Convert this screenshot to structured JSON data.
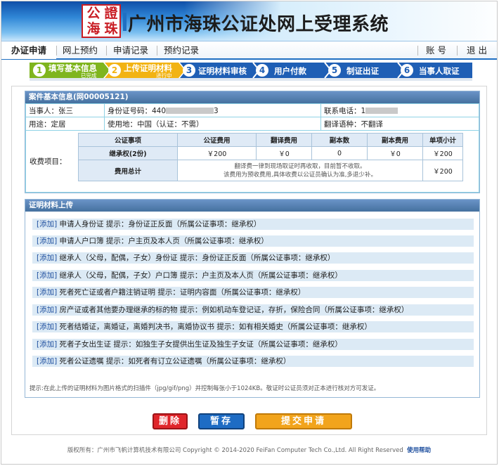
{
  "header": {
    "logo_chars": [
      "公",
      "證",
      "海",
      "珠"
    ],
    "title": "广州市海珠公证处网上受理系统"
  },
  "nav": {
    "items": [
      {
        "label": "办证申请",
        "active": true
      },
      {
        "label": "网上预约"
      },
      {
        "label": "申请记录"
      },
      {
        "label": "预约记录"
      }
    ],
    "account": "账 号",
    "logout": "退 出"
  },
  "steps": [
    {
      "num": "1",
      "label": "填写基本信息",
      "sub": "已完成"
    },
    {
      "num": "2",
      "label": "上传证明材料",
      "sub": "进行中"
    },
    {
      "num": "3",
      "label": "证明材料审核"
    },
    {
      "num": "4",
      "label": "用户付款"
    },
    {
      "num": "5",
      "label": "制证出证"
    },
    {
      "num": "6",
      "label": "当事人取证"
    }
  ],
  "case_info": {
    "title": "案件基本信息(网00005121)",
    "party": "当事人：张三",
    "id_label": "身份证号码：440",
    "id_tail": "3",
    "phone_label": "联系电话：1",
    "purpose": "用途：定居",
    "use_place": "使用地：中国（认证：不需）",
    "translate": "翻译语种：不翻译",
    "fee_label": "收费项目：",
    "fee_headers": [
      "公证事项",
      "公证费用",
      "翻译费用",
      "副本数",
      "副本费用",
      "单项小计"
    ],
    "fee_row": [
      "继承权(2份)",
      "￥200",
      "￥0",
      "0",
      "￥0",
      "￥200"
    ],
    "total_label": "费用总计",
    "total_note_1": "翻译费一律到现场取证时再收取，目前暂不收取。",
    "total_note_2": "该费用为预收费用,具体收费以公证员确认为准,多退少补。",
    "total_value": "￥200"
  },
  "upload": {
    "title": "证明材料上传",
    "add_label": "[添加]",
    "items": [
      "申请人身份证  提示：身份证正反面（所属公证事项：继承权）",
      "申请人户口簿  提示：户主页及本人页（所属公证事项：继承权）",
      "继承人（父母，配偶，子女）身份证  提示：身份证正反面（所属公证事项：继承权）",
      "继承人（父母，配偶，子女）户口簿  提示：户主页及本人页（所属公证事项：继承权）",
      "死者死亡证或者户籍注销证明  提示：证明内容面（所属公证事项：继承权）",
      "房产证或者其他要办理继承的标的物  提示：例如机动车登记证，存折，保险合同（所属公证事项：继承权）",
      "死者结婚证，离婚证，离婚判决书，离婚协议书  提示：如有相关婚史（所属公证事项：继承权）",
      "死者子女出生证  提示：如独生子女提供出生证及独生子女证（所属公证事项：继承权）",
      "死者公证遗嘱  提示：如死者有订立公证遗嘱（所属公证事项：继承权）"
    ],
    "hint": "提示:在此上传的证明材料为图片格式的扫描件（jpg/gif/png）并控制每张小于1024KB。敬证时公证员须对正本进行核对方可发证。"
  },
  "buttons": {
    "delete": "删除",
    "save": "暂存",
    "submit": "提交申请"
  },
  "footer": {
    "text": "版权所有：广州市飞帆计算机技术有限公司 Copyright © 2014-2020 FeiFan Computer Tech Co.,Ltd. All Right Reserved",
    "help": "使用帮助"
  },
  "colors": {
    "step_done": "#7fb51e",
    "step_active": "#f2b313",
    "step_todo": "#1f5fb5",
    "btn_delete": "#e0262b",
    "btn_save": "#1e6cc4",
    "btn_submit": "#f2a41c"
  }
}
